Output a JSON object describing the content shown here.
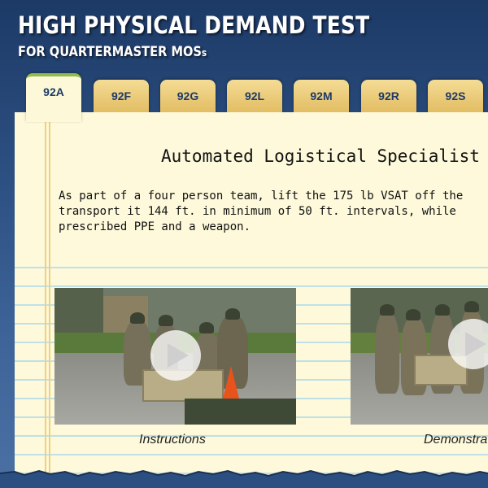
{
  "header": {
    "title": "HIGH PHYSICAL DEMAND TEST",
    "subtitle_main": "FOR QUARTERMASTER MOS",
    "subtitle_suffix": "s"
  },
  "tabs": [
    {
      "label": "92A",
      "active": true
    },
    {
      "label": "92F",
      "active": false
    },
    {
      "label": "92G",
      "active": false
    },
    {
      "label": "92L",
      "active": false
    },
    {
      "label": "92M",
      "active": false
    },
    {
      "label": "92R",
      "active": false
    },
    {
      "label": "92S",
      "active": false
    }
  ],
  "content": {
    "heading": "Automated Logistical Specialist",
    "description": "As part of a four person team, lift the 175 lb VSAT off the\ntransport it 144 ft. in minimum of 50 ft. intervals, while\nprescribed PPE and a weapon.",
    "videos": [
      {
        "caption": "Instructions",
        "icon": "play-icon"
      },
      {
        "caption": "Demonstra",
        "icon": "play-icon"
      }
    ]
  },
  "colors": {
    "background": "#2c4f82",
    "paper": "#fdf9da",
    "tab": "#e2bd63",
    "active_tab_accent": "#8fbc4a",
    "rule_line": "#bfe0e6",
    "tab_text": "#1d3a66"
  }
}
